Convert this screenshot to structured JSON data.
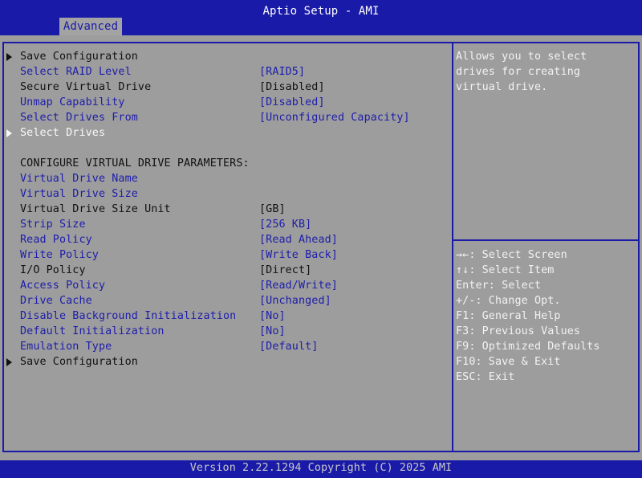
{
  "window_title": "Aptio Setup - AMI",
  "active_tab": "Advanced",
  "footer": "Version 2.22.1294 Copyright (C) 2025 AMI",
  "rows": [
    {
      "label": "Save Configuration",
      "value": "",
      "style": "black",
      "arrow": true
    },
    {
      "label": "Select RAID Level",
      "value": "[RAID5]",
      "style": "blue"
    },
    {
      "label": "Secure Virtual Drive",
      "value": "[Disabled]",
      "style": "black"
    },
    {
      "label": "Unmap Capability",
      "value": "[Disabled]",
      "style": "blue"
    },
    {
      "label": "Select Drives From",
      "value": "[Unconfigured Capacity]",
      "style": "blue"
    },
    {
      "label": "Select Drives",
      "value": "",
      "style": "white",
      "arrow": true
    },
    {
      "label": "",
      "value": "",
      "style": "black"
    },
    {
      "label": "CONFIGURE VIRTUAL DRIVE PARAMETERS:",
      "value": "",
      "style": "black"
    },
    {
      "label": "Virtual Drive Name",
      "value": "",
      "style": "blue"
    },
    {
      "label": "Virtual Drive Size",
      "value": "",
      "style": "blue"
    },
    {
      "label": "Virtual Drive Size Unit",
      "value": "[GB]",
      "style": "black"
    },
    {
      "label": "Strip Size",
      "value": "[256 KB]",
      "style": "blue"
    },
    {
      "label": "Read Policy",
      "value": "[Read Ahead]",
      "style": "blue"
    },
    {
      "label": "Write Policy",
      "value": "[Write Back]",
      "style": "blue"
    },
    {
      "label": "I/O Policy",
      "value": "[Direct]",
      "style": "black"
    },
    {
      "label": "Access Policy",
      "value": "[Read/Write]",
      "style": "blue"
    },
    {
      "label": "Drive Cache",
      "value": "[Unchanged]",
      "style": "blue"
    },
    {
      "label": "Disable Background Initialization",
      "value": "[No]",
      "style": "blue"
    },
    {
      "label": "Default Initialization",
      "value": "[No]",
      "style": "blue"
    },
    {
      "label": "Emulation Type",
      "value": "[Default]",
      "style": "blue"
    },
    {
      "label": "Save Configuration",
      "value": "",
      "style": "black",
      "arrow": true
    }
  ],
  "help_text": [
    "Allows you to select",
    "drives for creating",
    "virtual drive."
  ],
  "key_help": [
    "→←: Select Screen",
    "↑↓: Select Item",
    "Enter: Select",
    "+/-: Change Opt.",
    "F1: General Help",
    "F3: Previous Values",
    "F9: Optimized Defaults",
    "F10: Save & Exit",
    "ESC: Exit"
  ],
  "colors": {
    "header": "#1a1aa8",
    "background": "#9d9d9d",
    "selected": "#f8f8f8",
    "link": "#1d1dab"
  }
}
